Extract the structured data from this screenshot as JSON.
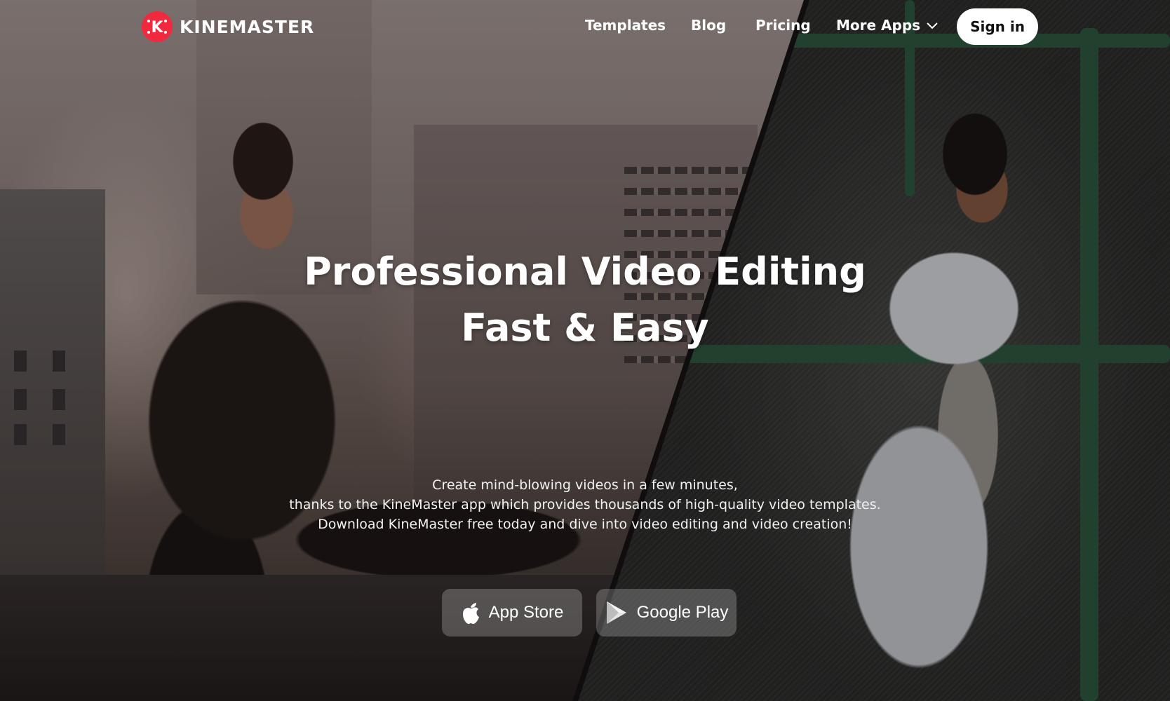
{
  "brand": {
    "name": "KINEMASTER",
    "accent_color": "#f1293f",
    "logo_icon": "kinemaster-logo-icon"
  },
  "nav": {
    "links": [
      "Templates",
      "Blog",
      "Pricing"
    ],
    "more_apps": {
      "label": "More Apps",
      "icon": "chevron-down-icon"
    },
    "sign_in": "Sign in"
  },
  "hero": {
    "headline_line1": "Professional Video Editing",
    "headline_line2": "Fast & Easy",
    "description": [
      "Create mind-blowing videos in a few minutes,",
      "thanks to the KineMaster app which provides thousands of high-quality video templates.",
      "Download KineMaster free today and dive into video editing and video creation!"
    ],
    "stores": [
      {
        "label": "App Store",
        "icon": "apple-icon"
      },
      {
        "label": "Google Play",
        "icon": "google-play-icon"
      }
    ]
  }
}
